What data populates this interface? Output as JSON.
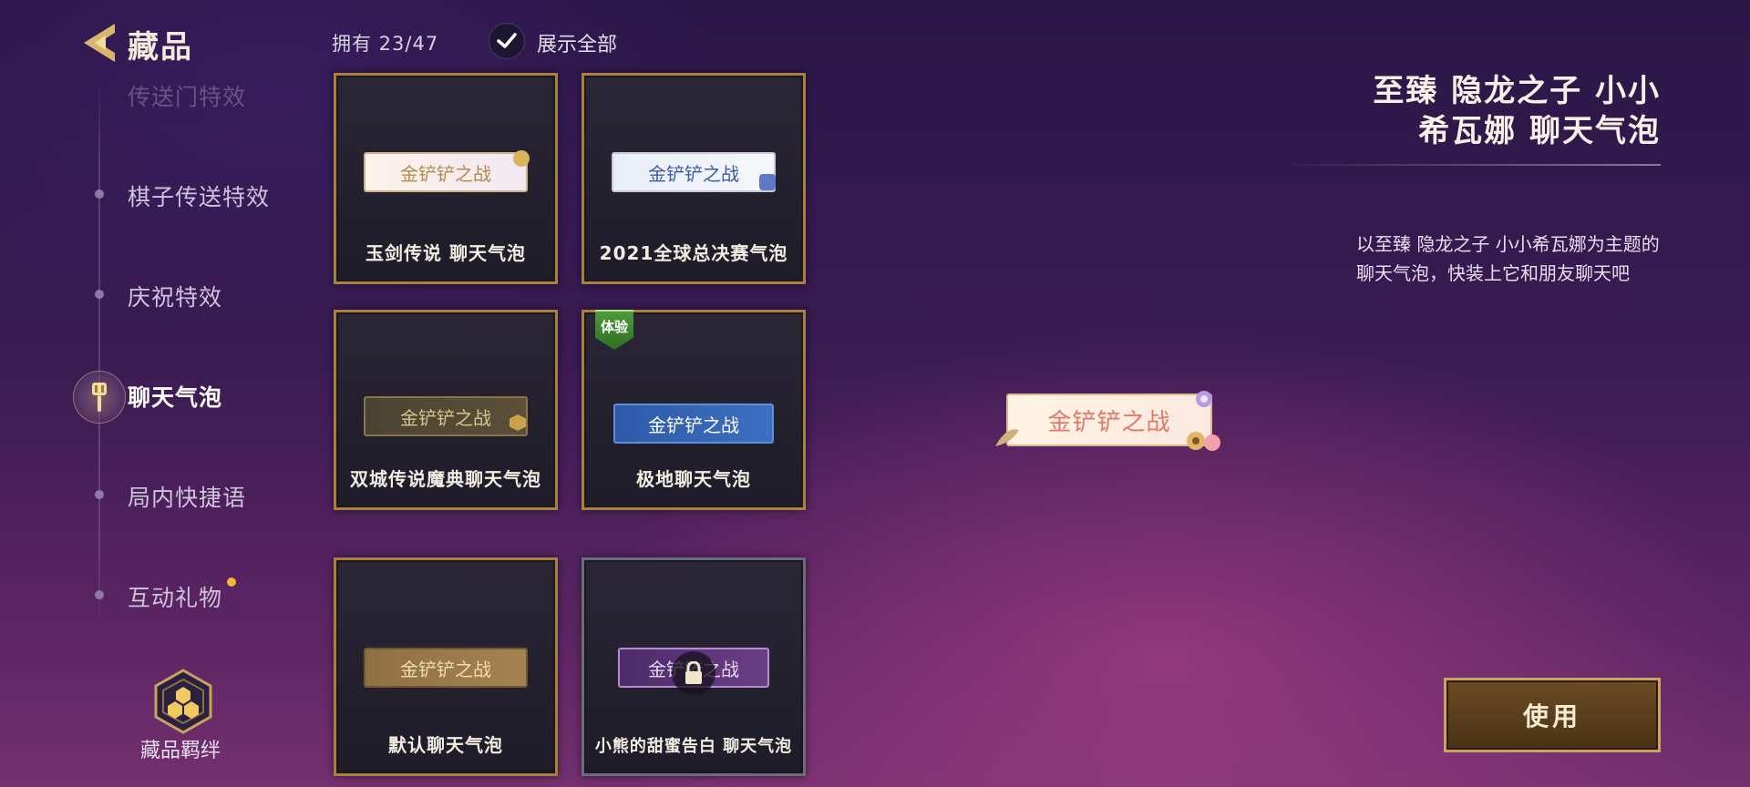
{
  "header": {
    "title": "藏品",
    "owned_label": "拥有 23/47",
    "show_all_label": "展示全部"
  },
  "sidebar": {
    "items": [
      {
        "label": "传送门特效"
      },
      {
        "label": "棋子传送特效"
      },
      {
        "label": "庆祝特效"
      },
      {
        "label": "聊天气泡"
      },
      {
        "label": "局内快捷语"
      },
      {
        "label": "互动礼物"
      }
    ],
    "bond_label": "藏品羁绊"
  },
  "cards": [
    {
      "name": "玉剑传说  聊天气泡",
      "bubble_text": "金铲铲之战"
    },
    {
      "name": "2021全球总决赛气泡",
      "bubble_text": "金铲铲之战"
    },
    {
      "name": "双城传说魔典聊天气泡",
      "bubble_text": "金铲铲之战"
    },
    {
      "name": "极地聊天气泡",
      "bubble_text": "金铲铲之战",
      "tag": "体验"
    },
    {
      "name": "默认聊天气泡",
      "bubble_text": "金铲铲之战"
    },
    {
      "name": "小熊的甜蜜告白  聊天气泡",
      "bubble_text": "金铲铲之战",
      "locked": true
    }
  ],
  "detail": {
    "title_line1": "至臻  隐龙之子  小小",
    "title_line2": "希瓦娜  聊天气泡",
    "description": "以至臻  隐龙之子  小小希瓦娜为主题的聊天气泡，快装上它和朋友聊天吧",
    "preview_text": "金铲铲之战",
    "use_button": "使用"
  },
  "colors": {
    "accent_gold": "#a8823c",
    "notification": "#f0b63a",
    "trial_tag": "#4f9a3b"
  }
}
